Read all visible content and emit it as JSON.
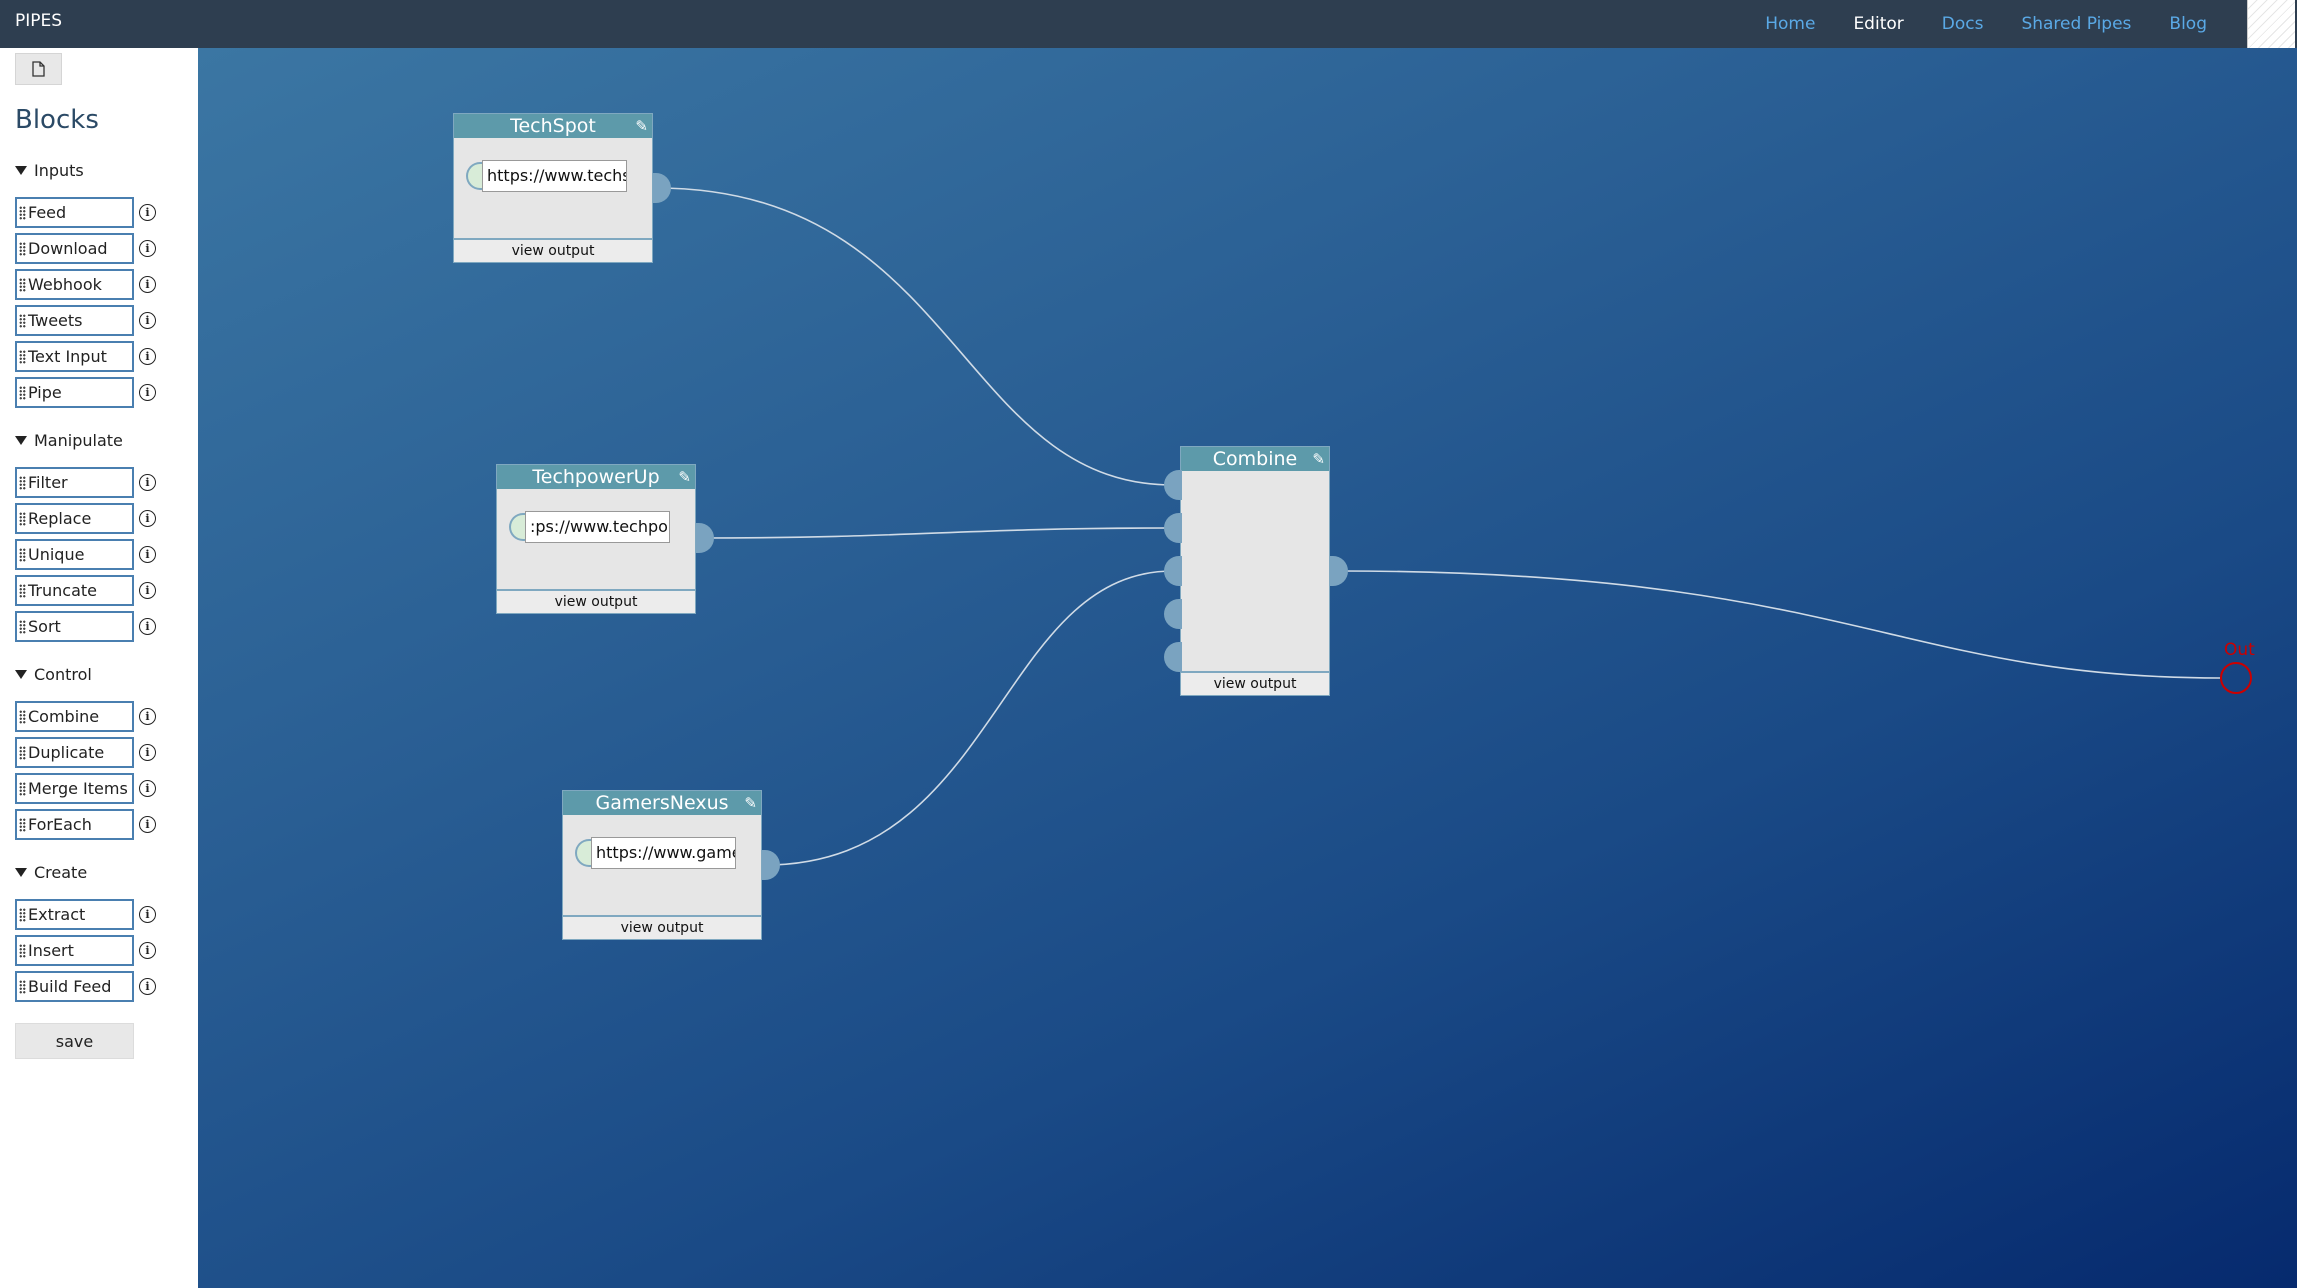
{
  "topbar": {
    "brand": "PIPES",
    "nav": [
      "Home",
      "Editor",
      "Docs",
      "Shared Pipes",
      "Blog"
    ],
    "active": "Editor"
  },
  "sidebar": {
    "title": "Blocks",
    "save_label": "save",
    "sections": [
      {
        "name": "Inputs",
        "items": [
          "Feed",
          "Download",
          "Webhook",
          "Tweets",
          "Text Input",
          "Pipe"
        ]
      },
      {
        "name": "Manipulate",
        "items": [
          "Filter",
          "Replace",
          "Unique",
          "Truncate",
          "Sort"
        ]
      },
      {
        "name": "Control",
        "items": [
          "Combine",
          "Duplicate",
          "Merge Items",
          "ForEach"
        ]
      },
      {
        "name": "Create",
        "items": [
          "Extract",
          "Insert",
          "Build Feed"
        ]
      }
    ]
  },
  "nodes": {
    "techspot": {
      "title": "TechSpot",
      "url": "https://www.techs",
      "footer": "view output"
    },
    "techpowerup": {
      "title": "TechpowerUp",
      "url": ":ps://www.techpo",
      "footer": "view output"
    },
    "gamersnexus": {
      "title": "GamersNexus",
      "url": "https://www.game",
      "footer": "view output"
    },
    "combine": {
      "title": "Combine",
      "footer": "view output"
    }
  },
  "output": {
    "label": "Out"
  },
  "colors": {
    "topbar": "#2e3e50",
    "node_header": "#5d9aaa",
    "nav_link": "#5aa9e6",
    "out": "#cc0000"
  }
}
